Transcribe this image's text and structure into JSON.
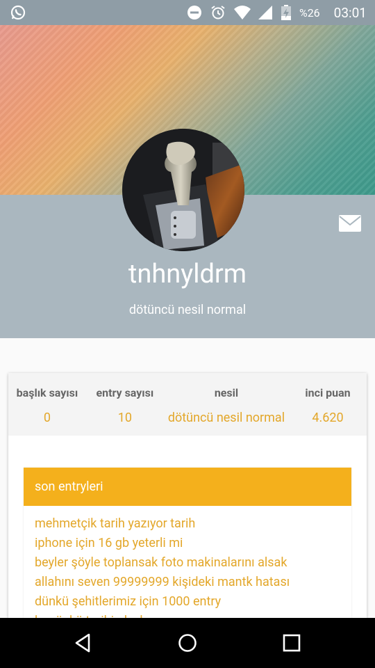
{
  "status_bar": {
    "battery": "%26",
    "time": "03:01",
    "icons": [
      "whatsapp-icon",
      "do-not-disturb-icon",
      "alarm-icon",
      "wifi-icon",
      "signal-icon",
      "battery-charging-icon"
    ]
  },
  "profile": {
    "username": "tnhnyldrm",
    "subtitle": "dötüncü nesil normal"
  },
  "stats": [
    {
      "label": "başlık sayısı",
      "value": "0"
    },
    {
      "label": "entry sayısı",
      "value": "10"
    },
    {
      "label": "nesil",
      "value": "dötüncü nesil normal"
    },
    {
      "label": "inci puan",
      "value": "4.620"
    }
  ],
  "entries": {
    "header": "son entryleri",
    "items": [
      "mehmetçik tarih yazıyor tarih",
      "iphone için 16 gb yeterli mi",
      "beyler şöyle toplansak foto makinalarını alsak",
      "allahını seven 99999999 kişideki mantk hatası",
      "dünkü şehitlerimiz için 1000 entry",
      "bugünkü tarihi olaylar"
    ]
  },
  "colors": {
    "accent": "#f4b01c",
    "accent_text": "#e3a72a",
    "profile_band": "#aab7bf",
    "status_bar": "#8f9da6"
  }
}
